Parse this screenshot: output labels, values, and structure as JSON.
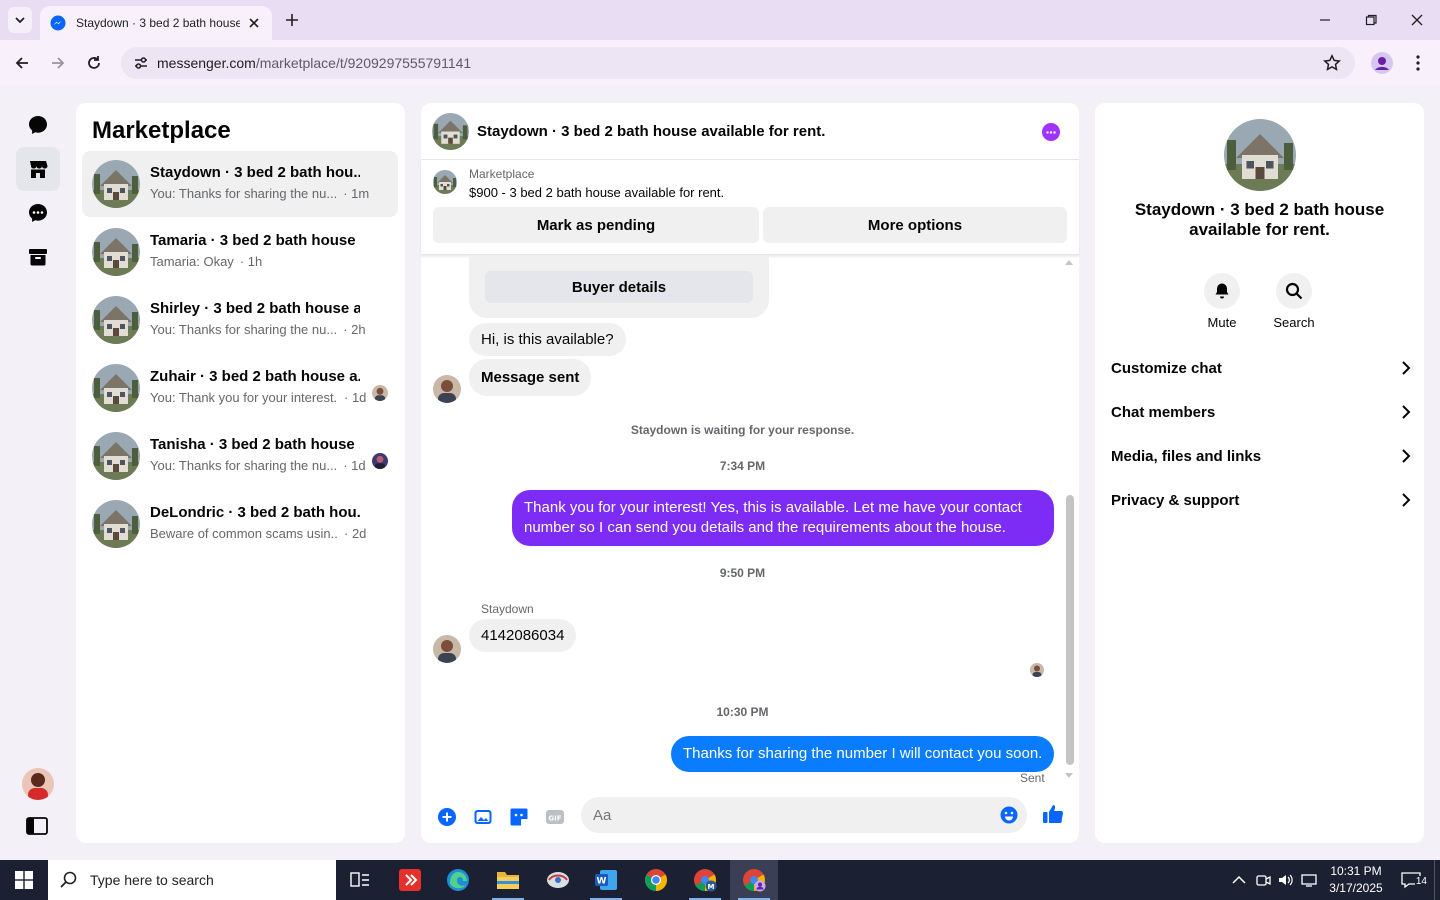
{
  "browser": {
    "tab_title": "Staydown · 3 bed 2 bath house",
    "url_host": "messenger.com",
    "url_path": "/marketplace/t/9209297555791141"
  },
  "conversations": {
    "title": "Marketplace",
    "items": [
      {
        "name": "Staydown · 3 bed 2 bath hou...",
        "preview": "You: Thanks for sharing the nu...",
        "time": "· 1m",
        "active": true
      },
      {
        "name": "Tamaria · 3 bed 2 bath house ...",
        "preview": "Tamaria: Okay",
        "time": "· 1h"
      },
      {
        "name": "Shirley · 3 bed 2 bath house a...",
        "preview": "You: Thanks for sharing the nu...",
        "time": "· 2h"
      },
      {
        "name": "Zuhair · 3 bed 2 bath house a...",
        "preview": "You: Thank you for your interest...",
        "time": "· 1d"
      },
      {
        "name": "Tanisha · 3 bed 2 bath house ...",
        "preview": "You: Thanks for sharing the nu...",
        "time": "· 1d"
      },
      {
        "name": "DeLondric · 3 bed 2 bath hou...",
        "preview": "Beware of common scams usin...",
        "time": "· 2d"
      }
    ]
  },
  "chat": {
    "title": "Staydown · 3 bed 2 bath house available for rent.",
    "listing_source": "Marketplace",
    "listing_price": "$900 - 3 bed 2 bath house available for rent.",
    "mark_pending": "Mark as pending",
    "more_options": "More options",
    "buyer_details": "Buyer details",
    "msg_available": "Hi, is this available?",
    "msg_sent": "Message sent",
    "waiting": "Staydown is waiting for your response.",
    "time1": "7:34 PM",
    "reply1": "Thank you for your interest! Yes, this is available. Let me have your contact number so I can send you details and the requirements about the house.",
    "time2": "9:50 PM",
    "sender": "Staydown",
    "phone": "4142086034",
    "time3": "10:30 PM",
    "reply2": "Thanks for sharing the number I will contact you soon.",
    "status": "Sent",
    "input_placeholder": "Aa"
  },
  "info": {
    "title": "Staydown · 3 bed 2 bath house available for rent.",
    "mute": "Mute",
    "search": "Search",
    "rows": [
      "Customize chat",
      "Chat members",
      "Media, files and links",
      "Privacy & support"
    ]
  },
  "taskbar": {
    "search_placeholder": "Type here to search",
    "time": "10:31 PM",
    "date": "3/17/2025",
    "notifications": "14"
  },
  "colors": {
    "accent": "#7d2cf5",
    "blue_bubble": "#0a7cff",
    "messenger_blue": "#0866ff"
  }
}
